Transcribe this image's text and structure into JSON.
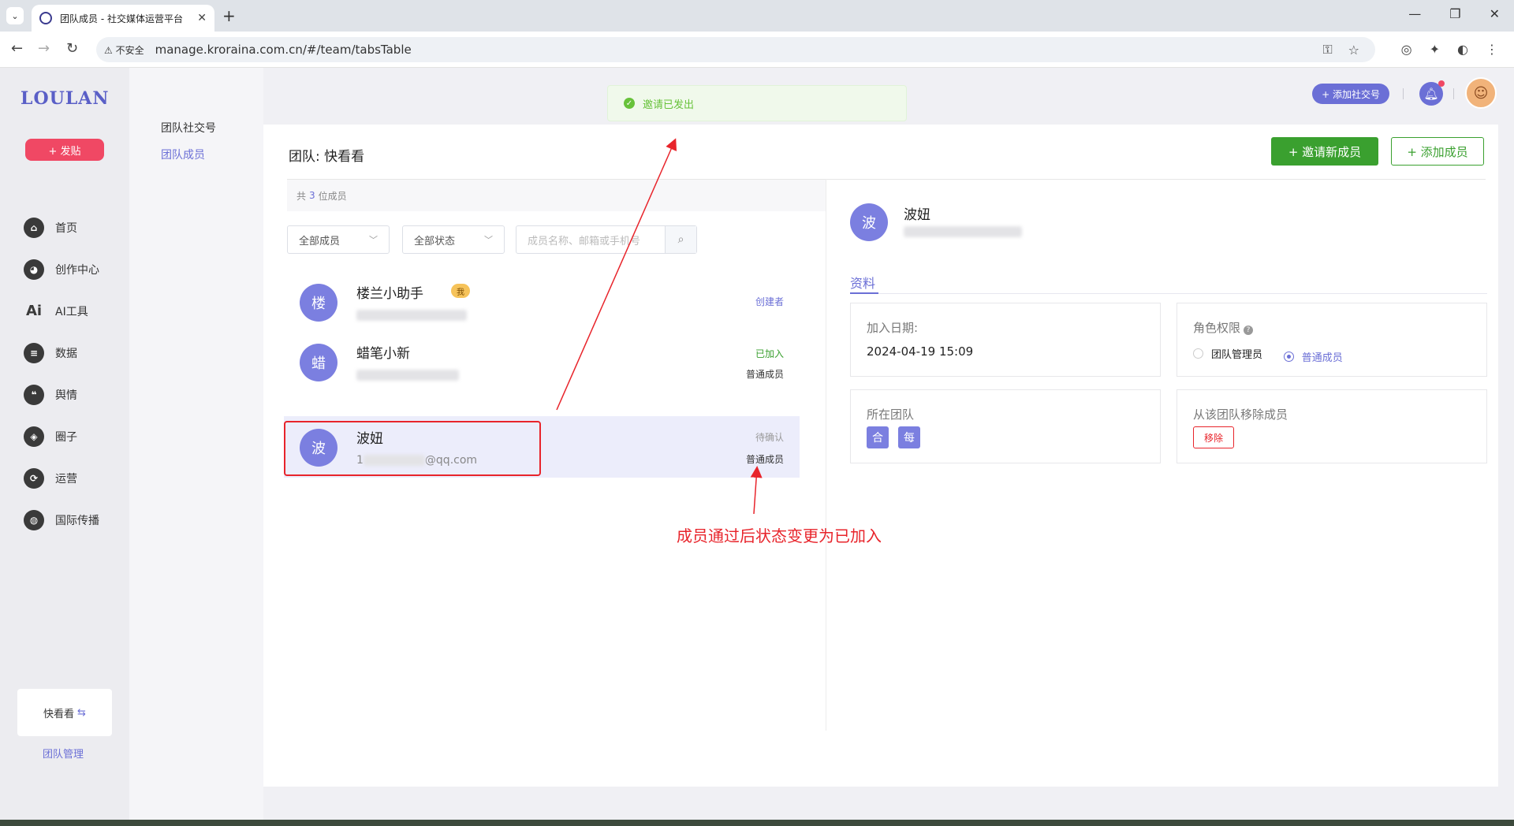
{
  "browser": {
    "tab_title": "团队成员 - 社交媒体运营平台",
    "url_warning": "不安全",
    "url": "manage.kroraina.com.cn/#/team/tabsTable"
  },
  "sidebar": {
    "logo": "LOULAN",
    "post_button": "+ 发贴",
    "items": [
      {
        "label": "首页",
        "icon": "home-icon"
      },
      {
        "label": "创作中心",
        "icon": "palette-icon"
      },
      {
        "label": "AI工具",
        "icon": "ai-icon"
      },
      {
        "label": "数据",
        "icon": "database-icon"
      },
      {
        "label": "舆情",
        "icon": "quote-icon"
      },
      {
        "label": "圈子",
        "icon": "compass-icon"
      },
      {
        "label": "运营",
        "icon": "operation-icon"
      },
      {
        "label": "国际传播",
        "icon": "globe-icon"
      }
    ],
    "team_name": "快看看",
    "team_manage": "团队管理"
  },
  "subnav": {
    "items": [
      "团队社交号",
      "团队成员"
    ],
    "active": "团队成员"
  },
  "header": {
    "add_account": "+ 添加社交号"
  },
  "toast": {
    "message": "邀请已发出"
  },
  "main": {
    "team_title": "团队: 快看看",
    "invite_button": "+ 邀请新成员",
    "add_member_button": "+ 添加成员",
    "count_prefix": "共",
    "count": "3",
    "count_suffix": "位成员",
    "filter_member": "全部成员",
    "filter_status": "全部状态",
    "search_placeholder": "成员名称、邮箱或手机号",
    "members": [
      {
        "avatar": "楼",
        "name": "楼兰小助手",
        "badge": "我",
        "status": "创建者",
        "role": ""
      },
      {
        "avatar": "蜡",
        "name": "蜡笔小新",
        "badge": "",
        "status": "已加入",
        "role": "普通成员"
      },
      {
        "avatar": "波",
        "name": "波妞",
        "badge": "",
        "email_prefix": "1",
        "email_suffix": "@qq.com",
        "status": "待确认",
        "role": "普通成员"
      }
    ]
  },
  "detail": {
    "avatar": "波",
    "name": "波妞",
    "tab": "资料",
    "join_date_label": "加入日期:",
    "join_date": "2024-04-19 15:09",
    "role_label": "角色权限",
    "role_options": [
      "团队管理员",
      "普通成员"
    ],
    "role_selected": "普通成员",
    "team_label": "所在团队",
    "teams": [
      "合",
      "每"
    ],
    "remove_label": "从该团队移除成员",
    "remove_button": "移除"
  },
  "annotation": {
    "text": "成员通过后状态变更为已加入"
  },
  "colors": {
    "accent": "#6b6fd6",
    "green": "#3aa02f",
    "red": "#e8242b",
    "post": "#f04864"
  }
}
